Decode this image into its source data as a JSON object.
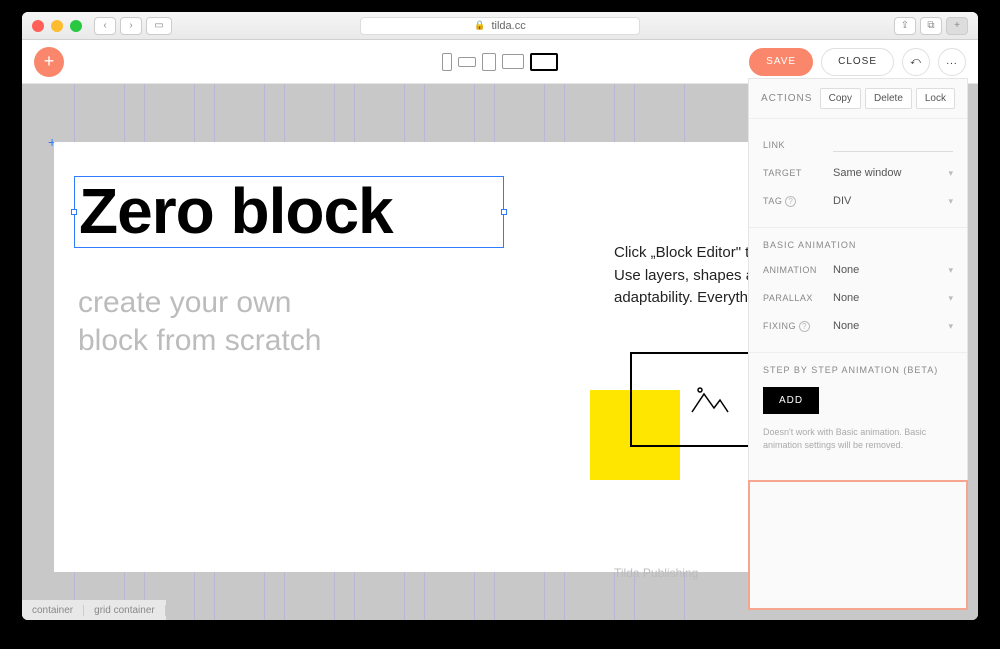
{
  "browser": {
    "url_host": "tilda.cc",
    "lock_icon": "lock-icon"
  },
  "toolbar": {
    "save": "SAVE",
    "close": "CLOSE",
    "undo_glyph": "⤺",
    "more_glyph": "..."
  },
  "canvas": {
    "heading": "Zero block",
    "subheading_line1": "create your own",
    "subheading_line2": "block from scratch",
    "body_line1": "Click „Block Editor\" to enter the",
    "body_line2": "Use layers, shapes and customize",
    "body_line3": "adaptability. Everything is possible.",
    "footer": "Tilda Publishing"
  },
  "breadcrumb": {
    "a": "container",
    "b": "grid container"
  },
  "panel": {
    "actions_label": "ACTIONS",
    "copy": "Copy",
    "delete": "Delete",
    "lock": "Lock",
    "link_label": "LINK",
    "target_label": "TARGET",
    "target_value": "Same window",
    "tag_label": "TAG",
    "tag_value": "DIV",
    "basic_anim_title": "BASIC ANIMATION",
    "animation_label": "ANIMATION",
    "animation_value": "None",
    "parallax_label": "PARALLAX",
    "parallax_value": "None",
    "fixing_label": "FIXING",
    "fixing_value": "None",
    "step_title": "STEP BY STEP ANIMATION (BETA)",
    "add": "ADD",
    "step_note": "Doesn't work with Basic animation. Basic animation settings will be removed."
  }
}
